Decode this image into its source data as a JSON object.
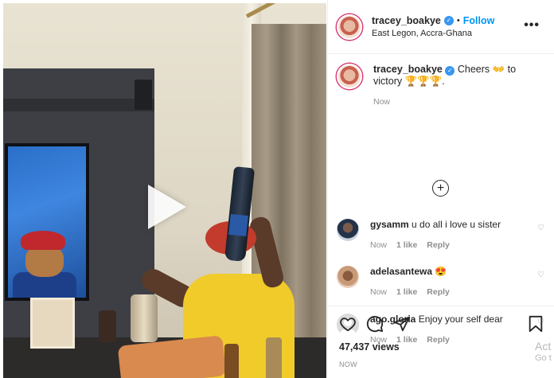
{
  "header": {
    "username": "tracey_boakye",
    "follow_label": "Follow",
    "separator": "•",
    "location": "East Legon, Accra-Ghana",
    "more_icon": "•••"
  },
  "caption": {
    "username": "tracey_boakye",
    "text": "Cheers 👐 to victory 🏆🏆🏆.",
    "time": "Now"
  },
  "load_more_icon": "+",
  "comments": [
    {
      "username": "gysamm",
      "text": "u do all i love u sister",
      "time": "Now",
      "likes": "1 like",
      "reply": "Reply"
    },
    {
      "username": "adelasantewa",
      "text": "😍",
      "time": "Now",
      "likes": "1 like",
      "reply": "Reply"
    },
    {
      "username": "ago.gloria",
      "text": "Enjoy your self dear",
      "time": "Now",
      "likes": "1 like",
      "reply": "Reply"
    }
  ],
  "stats": {
    "views": "47,437 views",
    "posted": "NOW"
  },
  "watermark": {
    "line1": "Act",
    "line2": "Go t"
  },
  "colors": {
    "follow": "#0095f6",
    "verified": "#3897f0",
    "muted": "#8e8e8e",
    "text": "#262626"
  }
}
